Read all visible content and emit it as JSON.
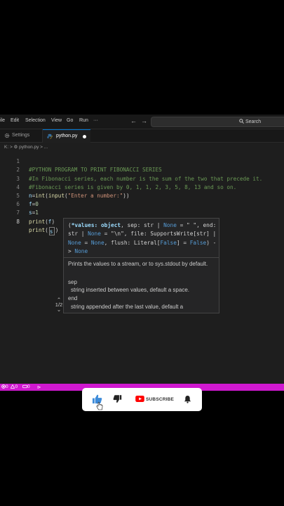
{
  "menubar": {
    "items": [
      "ile",
      "Edit",
      "Selection",
      "View",
      "Go",
      "Run",
      "···"
    ],
    "back_arrow": "←",
    "forward_arrow": "→",
    "search_placeholder": "Search"
  },
  "tabs": [
    {
      "label": "Settings",
      "icon": "gear-icon"
    },
    {
      "label": "python.py",
      "icon": "python-file-icon",
      "modified": true
    }
  ],
  "breadcrumb": "K: > ⚙ python.py > ...",
  "editor": {
    "lines": [
      {
        "n": "1",
        "text": "#PYTHON PROGRAM TO PRINT FIBONACCI SERIES"
      },
      {
        "n": "2",
        "text": "#In Fibonacci series, each number is the sum of the two that precede it."
      },
      {
        "n": "3",
        "text": "#Fibonacci series is given by 0, 1, 1, 2, 3, 5, 8, 13 and so on."
      },
      {
        "n": "4",
        "text": "n=int(input(\"Enter a number:\"))"
      },
      {
        "n": "5",
        "text": "f=0"
      },
      {
        "n": "6",
        "text": "s=1"
      },
      {
        "n": "7",
        "text": "print(f)"
      },
      {
        "n": "8",
        "text": "print(s)"
      }
    ]
  },
  "hover": {
    "signature_parts": {
      "open": "(",
      "param1": "*values: object",
      "rest1": ", sep: str | ",
      "none1": "None",
      "rest2": " = \" \", end: str | ",
      "none2": "None",
      "rest3": " = \"\\n\", file: SupportsWrite[str] | ",
      "none3": "None",
      "rest4": " = ",
      "none4": "None",
      "rest5": ", flush: Literal[",
      "false1": "False",
      "rest6": "] = ",
      "false2": "False",
      "rest7": ") -> ",
      "none5": "None"
    },
    "description": "Prints the values to a stream, or to sys.stdout by default.",
    "params": [
      {
        "name": "sep",
        "desc": "string inserted between values, default a space."
      },
      {
        "name": "end",
        "desc": "string appended after the last value, default a"
      }
    ],
    "overload": "1/2"
  },
  "statusbar": {
    "errors": "0",
    "warnings": "0",
    "ports": "0"
  },
  "youtube": {
    "subscribe_label": "SUBSCRIBE"
  },
  "colors": {
    "statusbar": "#d018d0",
    "comment": "#6a9955",
    "identifier": "#9cdcfe",
    "function": "#dcdcaa",
    "string": "#ce9178",
    "number": "#b5cea8",
    "like_blue": "#3d8bd9",
    "youtube_red": "#ff0000"
  }
}
